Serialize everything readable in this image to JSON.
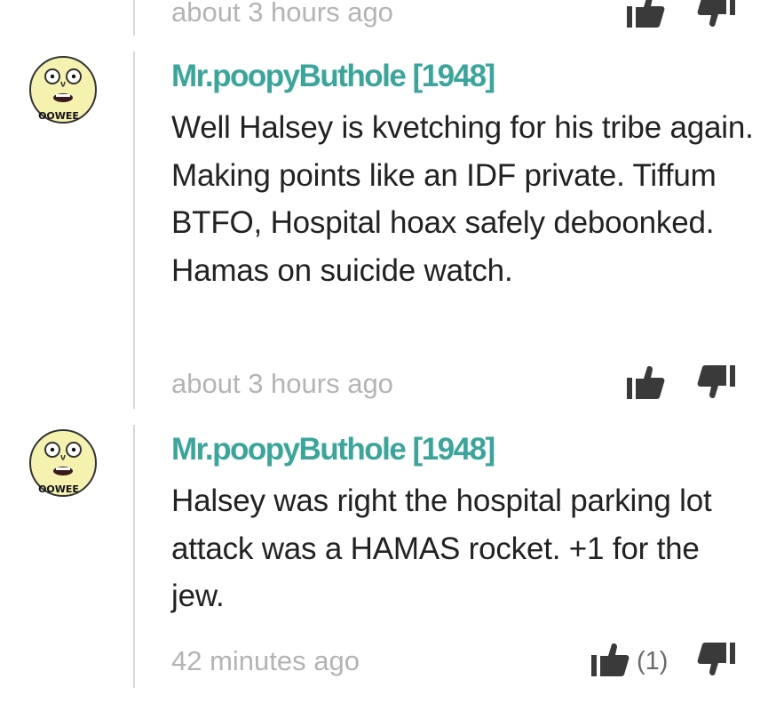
{
  "comments_partial_top": {
    "timestamp": "about 3 hours ago"
  },
  "comments": [
    {
      "author": "Mr.poopyButhole [1948]",
      "avatar_label": "OOWEE",
      "text": "Well Halsey is kvetching for his tribe again. Making points like an IDF private. Tiffum BTFO, Hospital hoax safely deboonked. Hamas on suicide watch.",
      "timestamp": "about 3 hours ago",
      "upvote_count": ""
    },
    {
      "author": "Mr.poopyButhole [1948]",
      "avatar_label": "OOWEE",
      "text": "Halsey was right the hospital parking lot attack was a HAMAS rocket. +1 for the jew.",
      "timestamp": "42 minutes ago",
      "upvote_count": "(1)"
    }
  ],
  "colors": {
    "author": "#3aa69b",
    "text": "#222222",
    "timestamp": "#b4b4b4",
    "divider": "#d7d7d7",
    "icon": "#3a3a3a",
    "avatar_face": "#f5f2b0"
  },
  "icons": {
    "upvote": "thumbs-up-icon",
    "downvote": "thumbs-down-icon"
  }
}
